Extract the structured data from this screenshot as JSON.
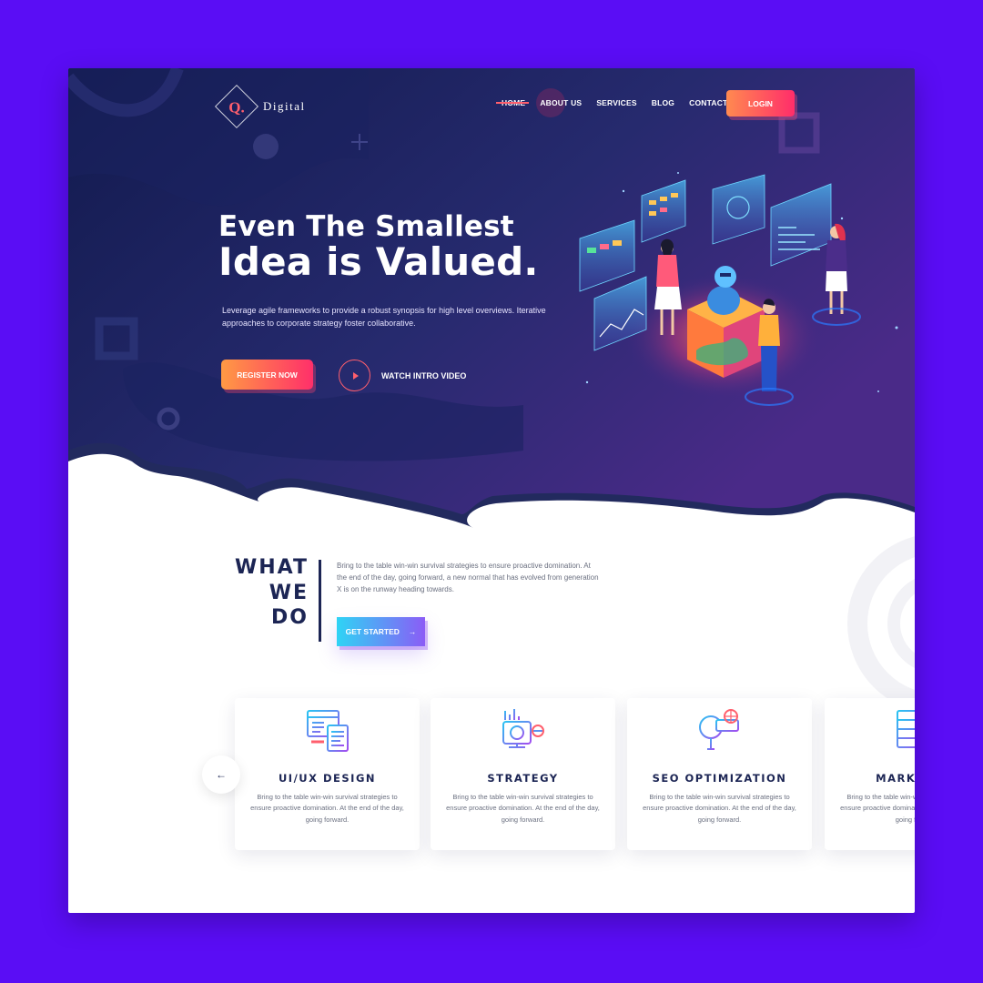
{
  "brand": {
    "logo_letter": "Q.",
    "name": "Digital"
  },
  "nav": {
    "items": [
      {
        "label": "HOME",
        "active": true
      },
      {
        "label": "ABOUT US"
      },
      {
        "label": "SERVICES"
      },
      {
        "label": "BLOG"
      },
      {
        "label": "CONTACT"
      }
    ],
    "login_label": "LOGIN"
  },
  "hero": {
    "title_line1": "Even The Smallest",
    "title_line2": "Idea is Valued.",
    "description": "Leverage agile frameworks to provide a robust synopsis for high level overviews. Iterative approaches to corporate strategy foster collaborative.",
    "register_label": "REGISTER NOW",
    "watch_label": "WATCH INTRO VIDEO"
  },
  "what_we_do": {
    "title_lines": [
      "WHAT",
      "WE",
      "DO"
    ],
    "text": "Bring to the table win-win survival strategies to ensure proactive domination. At the end of the day, going forward, a new normal that has evolved from generation X is on the runway heading towards.",
    "cta_label": "GET STARTED",
    "cta_icon": "→"
  },
  "carousel": {
    "prev_icon": "←",
    "cards": [
      {
        "icon": "ui-ux-icon",
        "title": "UI/UX DESIGN",
        "text": "Bring to the table win-win survival strategies to ensure proactive domination. At the end of the day, going forward."
      },
      {
        "icon": "strategy-icon",
        "title": "STRATEGY",
        "text": "Bring to the table win-win survival strategies to ensure proactive domination. At the end of the day, going forward."
      },
      {
        "icon": "seo-icon",
        "title": "SEO OPTIMIZATION",
        "text": "Bring to the table win-win survival strategies to ensure proactive domination. At the end of the day, going forward."
      },
      {
        "icon": "marketing-icon",
        "title": "MARKETING",
        "text": "Bring to the table win-win survival strategies to ensure proactive domination. At the end of the day, going forward."
      }
    ]
  },
  "colors": {
    "page_bg": "#5a0df5",
    "hero_dark": "#172057",
    "accent_orange": "#ff8a50",
    "accent_pink": "#ff2d6a",
    "heading_navy": "#1c2554",
    "cta_cyan": "#2ed4f5",
    "cta_purple": "#8b5cf6"
  }
}
